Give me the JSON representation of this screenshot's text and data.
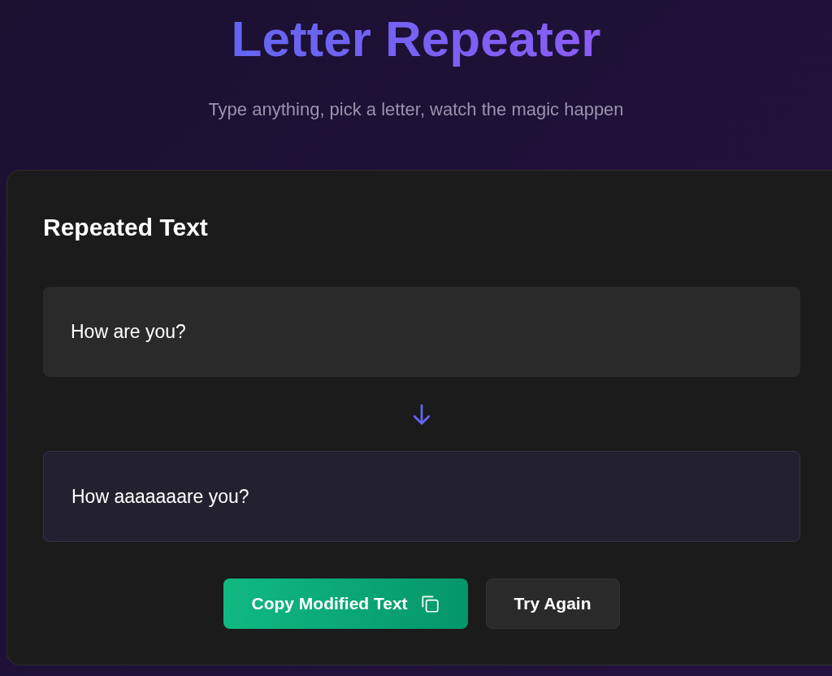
{
  "header": {
    "title": "Letter Repeater",
    "subtitle": "Type anything, pick a letter, watch the magic happen"
  },
  "card": {
    "heading": "Repeated Text",
    "original": "How are you?",
    "modified": "How aaaaaaare you?"
  },
  "buttons": [
    {
      "label": "Copy Modified Text",
      "kind": "primary"
    },
    {
      "label": "Try Again",
      "kind": "secondary"
    }
  ]
}
